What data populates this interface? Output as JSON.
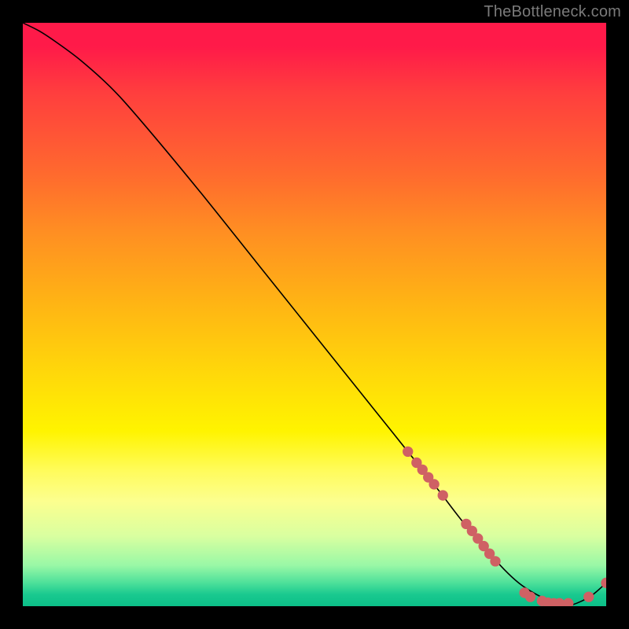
{
  "watermark": "TheBottleneck.com",
  "chart_data": {
    "type": "line",
    "title": "",
    "xlabel": "",
    "ylabel": "",
    "xlim": [
      0,
      100
    ],
    "ylim": [
      0,
      100
    ],
    "series": [
      {
        "name": "curve",
        "x": [
          0,
          3,
          6,
          10,
          15,
          20,
          30,
          40,
          50,
          60,
          70,
          75,
          80,
          85,
          90,
          93,
          97,
          100
        ],
        "y": [
          100,
          98.5,
          96.5,
          93.5,
          89,
          83.5,
          71.5,
          59,
          46.5,
          34,
          21.5,
          15,
          9,
          4,
          1,
          0,
          1.5,
          4
        ]
      }
    ],
    "markers": [
      {
        "x": 66.0,
        "y": 26.5
      },
      {
        "x": 67.5,
        "y": 24.6
      },
      {
        "x": 68.5,
        "y": 23.4
      },
      {
        "x": 69.5,
        "y": 22.1
      },
      {
        "x": 70.5,
        "y": 20.9
      },
      {
        "x": 72.0,
        "y": 19.0
      },
      {
        "x": 76.0,
        "y": 14.1
      },
      {
        "x": 77.0,
        "y": 12.9
      },
      {
        "x": 78.0,
        "y": 11.6
      },
      {
        "x": 79.0,
        "y": 10.3
      },
      {
        "x": 80.0,
        "y": 9.0
      },
      {
        "x": 81.0,
        "y": 7.7
      },
      {
        "x": 86.0,
        "y": 2.3
      },
      {
        "x": 87.0,
        "y": 1.6
      },
      {
        "x": 89.0,
        "y": 0.9
      },
      {
        "x": 90.0,
        "y": 0.6
      },
      {
        "x": 91.0,
        "y": 0.5
      },
      {
        "x": 92.0,
        "y": 0.5
      },
      {
        "x": 93.5,
        "y": 0.5
      },
      {
        "x": 97.0,
        "y": 1.6
      },
      {
        "x": 100.0,
        "y": 4.0
      }
    ],
    "marker_style": {
      "color": "#cf6164",
      "radius_frac": 0.009
    }
  }
}
